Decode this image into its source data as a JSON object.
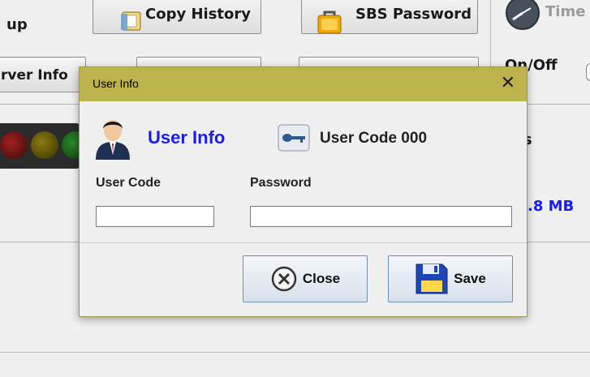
{
  "background": {
    "left_label": "up",
    "copy_history_label": "Copy History",
    "sbs_password_label": "SBS Password",
    "time_label": "Time",
    "server_info_label": "rver Info",
    "onoff_label": "On/Off",
    "status_label": "us",
    "size_label": ".8 MB"
  },
  "dialog": {
    "title": "User Info",
    "close_glyph": "✕",
    "heading": "User Info",
    "user_code_display": "User Code 000",
    "user_code_label": "User Code",
    "password_label": "Password",
    "user_code_value": "",
    "password_value": "",
    "close_button_label": "Close",
    "save_button_label": "Save"
  },
  "colors": {
    "titlebar": "#bdb34d",
    "heading": "#1a1aff",
    "status_blue": "#1a1aff"
  }
}
